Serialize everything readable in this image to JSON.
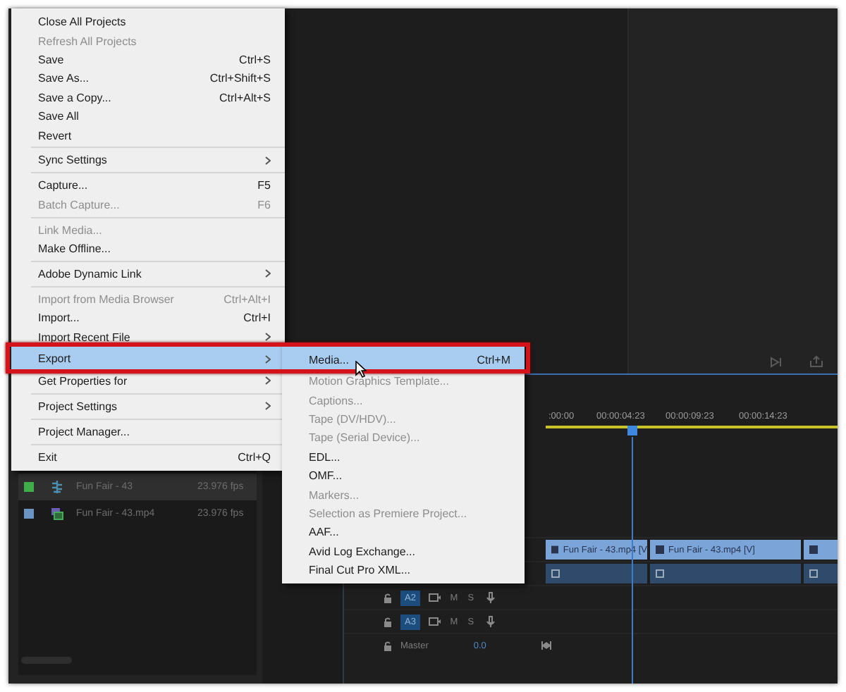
{
  "file_menu": {
    "items": [
      {
        "kind": "item",
        "label": "Close All Projects",
        "disabled": false,
        "selected": false
      },
      {
        "kind": "item",
        "label": "Refresh All Projects",
        "disabled": true,
        "selected": false
      },
      {
        "kind": "item",
        "label": "Save",
        "shortcut": "Ctrl+S",
        "disabled": false,
        "selected": false
      },
      {
        "kind": "item",
        "label": "Save As...",
        "shortcut": "Ctrl+Shift+S",
        "disabled": false,
        "selected": false
      },
      {
        "kind": "item",
        "label": "Save a Copy...",
        "shortcut": "Ctrl+Alt+S",
        "disabled": false,
        "selected": false
      },
      {
        "kind": "item",
        "label": "Save All",
        "disabled": false,
        "selected": false
      },
      {
        "kind": "item",
        "label": "Revert",
        "disabled": false,
        "selected": false
      },
      {
        "kind": "separator"
      },
      {
        "kind": "submenu",
        "label": "Sync Settings",
        "disabled": false,
        "selected": false
      },
      {
        "kind": "separator"
      },
      {
        "kind": "item",
        "label": "Capture...",
        "shortcut": "F5",
        "disabled": false,
        "selected": false
      },
      {
        "kind": "item",
        "label": "Batch Capture...",
        "shortcut": "F6",
        "disabled": true,
        "selected": false
      },
      {
        "kind": "separator"
      },
      {
        "kind": "item",
        "label": "Link Media...",
        "disabled": true,
        "selected": false
      },
      {
        "kind": "item",
        "label": "Make Offline...",
        "disabled": false,
        "selected": false
      },
      {
        "kind": "separator"
      },
      {
        "kind": "submenu",
        "label": "Adobe Dynamic Link",
        "disabled": false,
        "selected": false
      },
      {
        "kind": "separator"
      },
      {
        "kind": "item",
        "label": "Import from Media Browser",
        "shortcut": "Ctrl+Alt+I",
        "disabled": true,
        "selected": false
      },
      {
        "kind": "item",
        "label": "Import...",
        "shortcut": "Ctrl+I",
        "disabled": false,
        "selected": false
      },
      {
        "kind": "submenu",
        "label": "Import Recent File",
        "disabled": false,
        "selected": false
      },
      {
        "kind": "submenu",
        "label": "Export",
        "disabled": false,
        "selected": true
      },
      {
        "kind": "submenu",
        "label": "Get Properties for",
        "disabled": false,
        "selected": false
      },
      {
        "kind": "separator"
      },
      {
        "kind": "submenu",
        "label": "Project Settings",
        "disabled": false,
        "selected": false
      },
      {
        "kind": "separator"
      },
      {
        "kind": "item",
        "label": "Project Manager...",
        "disabled": false,
        "selected": false
      },
      {
        "kind": "separator"
      },
      {
        "kind": "item",
        "label": "Exit",
        "shortcut": "Ctrl+Q",
        "disabled": false,
        "selected": false
      }
    ]
  },
  "export_submenu": {
    "items": [
      {
        "kind": "item",
        "label": "Media...",
        "shortcut": "Ctrl+M",
        "disabled": false,
        "selected": true
      },
      {
        "kind": "item",
        "label": "Motion Graphics Template...",
        "disabled": true,
        "selected": false
      },
      {
        "kind": "item",
        "label": "Captions...",
        "disabled": true,
        "selected": false
      },
      {
        "kind": "item",
        "label": "Tape (DV/HDV)...",
        "disabled": true,
        "selected": false
      },
      {
        "kind": "item",
        "label": "Tape (Serial Device)...",
        "disabled": true,
        "selected": false
      },
      {
        "kind": "item",
        "label": "EDL...",
        "disabled": false,
        "selected": false
      },
      {
        "kind": "item",
        "label": "OMF...",
        "disabled": false,
        "selected": false
      },
      {
        "kind": "item",
        "label": "Markers...",
        "disabled": true,
        "selected": false
      },
      {
        "kind": "item",
        "label": "Selection as Premiere Project...",
        "disabled": true,
        "selected": false
      },
      {
        "kind": "item",
        "label": "AAF...",
        "disabled": false,
        "selected": false
      },
      {
        "kind": "item",
        "label": "Avid Log Exchange...",
        "disabled": false,
        "selected": false
      },
      {
        "kind": "item",
        "label": "Final Cut Pro XML...",
        "disabled": false,
        "selected": false
      }
    ]
  },
  "project_panel": {
    "items": [
      {
        "kind": "sequence",
        "name": "Fun Fair - 43",
        "fps": "23.976 fps",
        "color": "#3fae49",
        "selected": true
      },
      {
        "kind": "clip",
        "name": "Fun Fair - 43.mp4",
        "fps": "23.976 fps",
        "color": "#6b93c4",
        "selected": false
      }
    ]
  },
  "timeline": {
    "timecodes": [
      ":00:00",
      "00:00:04:23",
      "00:00:09:23",
      "00:00:14:23"
    ],
    "video_clips": [
      {
        "kind": "full",
        "name": "Fun Fair - 43.mp4 [V"
      },
      {
        "kind": "full",
        "name": "Fun Fair - 43.mp4 [V]"
      },
      {
        "kind": "partial"
      }
    ],
    "tracks": [
      {
        "label": "A2",
        "targeted": true,
        "mute": "M",
        "solo": "S"
      },
      {
        "label": "A3",
        "targeted": true,
        "mute": "M",
        "solo": "S"
      }
    ],
    "master": {
      "label": "Master",
      "value": "0.0"
    }
  }
}
